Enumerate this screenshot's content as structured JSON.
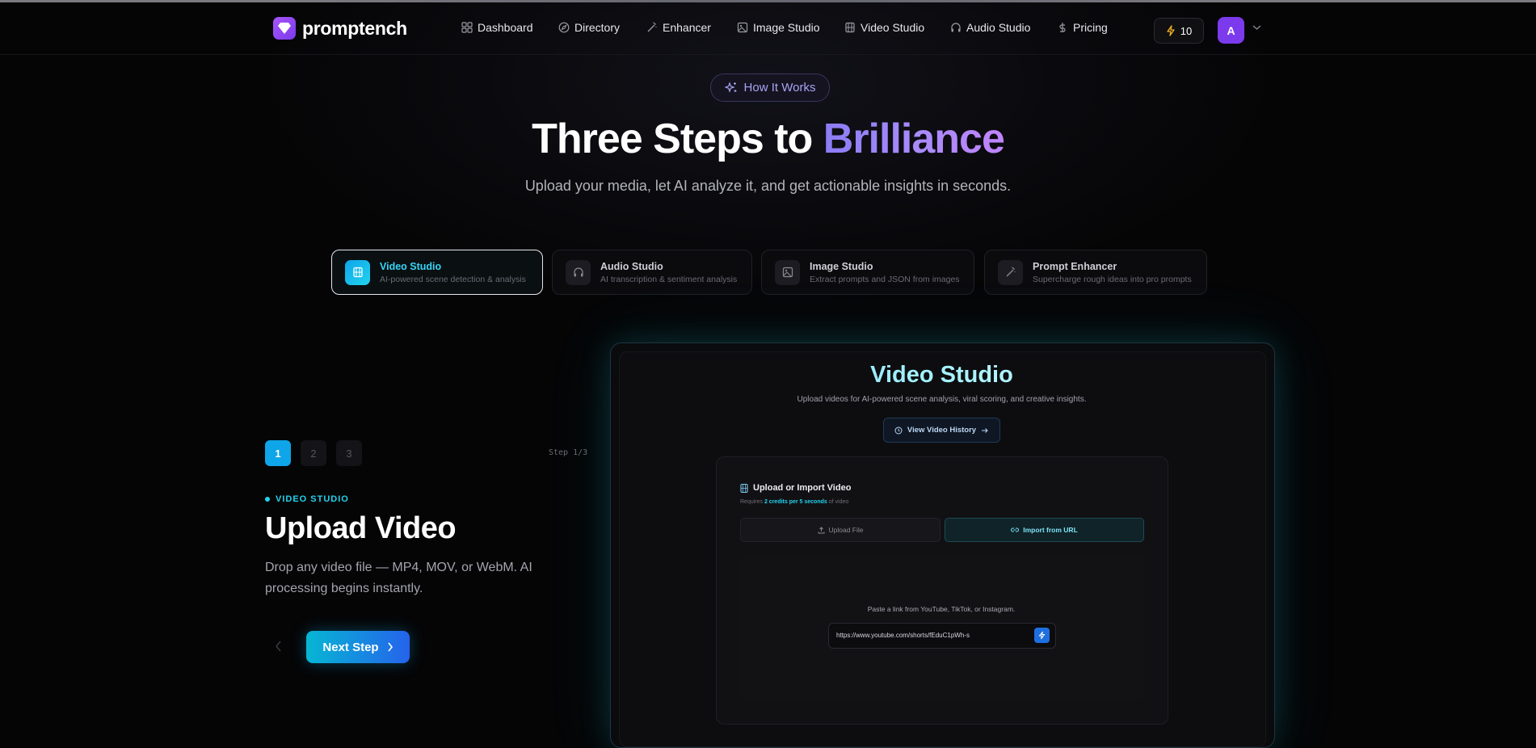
{
  "brand": {
    "name": "promptench",
    "color": "#8b5cf6"
  },
  "nav": {
    "items": [
      {
        "label": "Dashboard",
        "icon": "grid-icon"
      },
      {
        "label": "Directory",
        "icon": "compass-icon"
      },
      {
        "label": "Enhancer",
        "icon": "wand-icon"
      },
      {
        "label": "Image Studio",
        "icon": "image-icon"
      },
      {
        "label": "Video Studio",
        "icon": "film-icon"
      },
      {
        "label": "Audio Studio",
        "icon": "headphones-icon"
      },
      {
        "label": "Pricing",
        "icon": "dollar-icon"
      }
    ],
    "credits": "10",
    "avatar_initial": "A"
  },
  "hero": {
    "pill": "How It Works",
    "title_main": "Three Steps to",
    "title_accent": "Brilliance",
    "subtitle": "Upload your media, let AI analyze it, and get actionable insights in seconds."
  },
  "tabs": [
    {
      "title": "Video Studio",
      "desc": "AI-powered scene detection & analysis",
      "icon": "film-icon",
      "active": true
    },
    {
      "title": "Audio Studio",
      "desc": "AI transcription & sentiment analysis",
      "icon": "headphones-icon",
      "active": false
    },
    {
      "title": "Image Studio",
      "desc": "Extract prompts and JSON from images",
      "icon": "image-icon",
      "active": false
    },
    {
      "title": "Prompt Enhancer",
      "desc": "Supercharge rough ideas into pro prompts",
      "icon": "wand-icon",
      "active": false
    }
  ],
  "step": {
    "numbers": [
      "1",
      "2",
      "3"
    ],
    "current_label": "Step 1/3",
    "eyebrow": "VIDEO STUDIO",
    "title": "Upload Video",
    "description": "Drop any video file — MP4, MOV, or WebM. AI processing begins instantly.",
    "next_label": "Next Step"
  },
  "preview": {
    "title": "Video Studio",
    "subtitle": "Upload videos for AI-powered scene analysis, viral scoring, and creative insights.",
    "history_button": "View Video History",
    "card_title": "Upload or Import Video",
    "requires_prefix": "Requires",
    "requires_highlight": "2 credits per 5 seconds",
    "requires_suffix": "of video",
    "upload_label": "Upload File",
    "import_label": "Import from URL",
    "paste_hint": "Paste a link from YouTube, TikTok, or Instagram.",
    "url_value": "https://www.youtube.com/shorts/fEduC1pWh-s"
  },
  "colors": {
    "accent_cyan": "#22d3ee",
    "accent_blue": "#2563eb",
    "accent_purple": "#a78bfa"
  }
}
